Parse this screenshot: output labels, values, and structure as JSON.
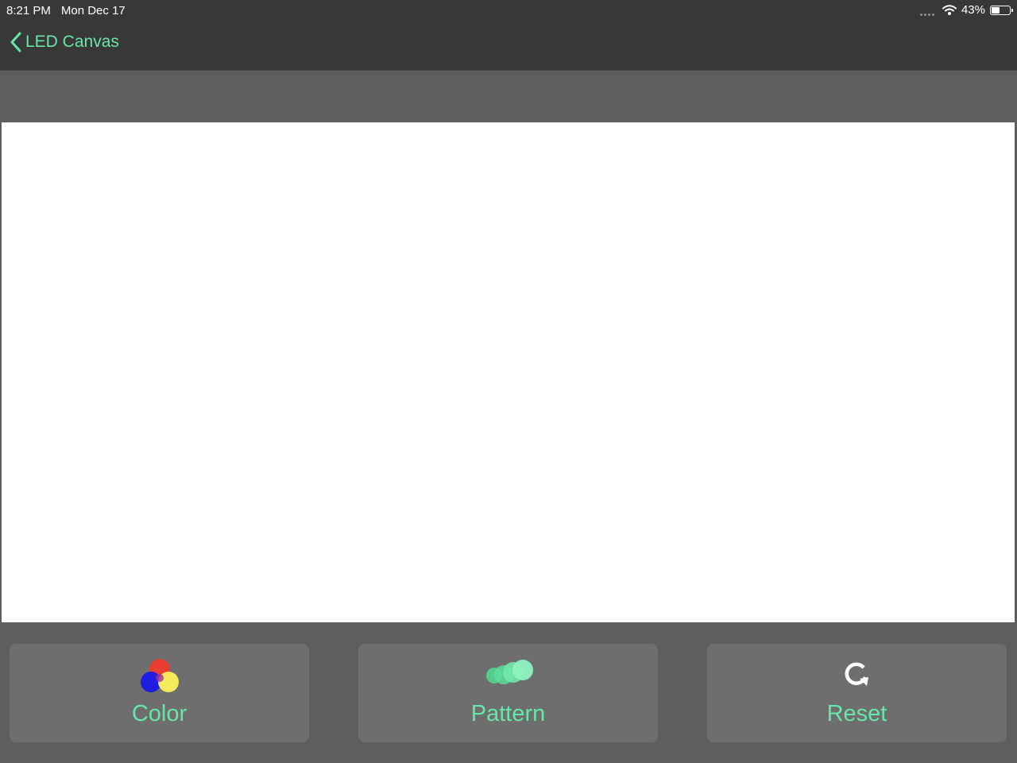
{
  "status": {
    "time": "8:21 PM",
    "date": "Mon Dec 17",
    "battery": "43%",
    "battery_level": 0.43,
    "wifi_icon": "wifi-icon",
    "signal_icon": "signal-dots-icon"
  },
  "nav": {
    "back_label": "LED Canvas",
    "back_icon": "chevron-left-icon"
  },
  "canvas": {
    "background": "#ffffff"
  },
  "actions": [
    {
      "label": "Color",
      "icon": "rgb-circles-icon"
    },
    {
      "label": "Pattern",
      "icon": "pattern-icon"
    },
    {
      "label": "Reset",
      "icon": "reset-icon"
    }
  ],
  "colors": {
    "accent": "#66e6a8",
    "bar": "#383838",
    "surface": "#5e5e5e",
    "button": "#6e6e6e"
  }
}
